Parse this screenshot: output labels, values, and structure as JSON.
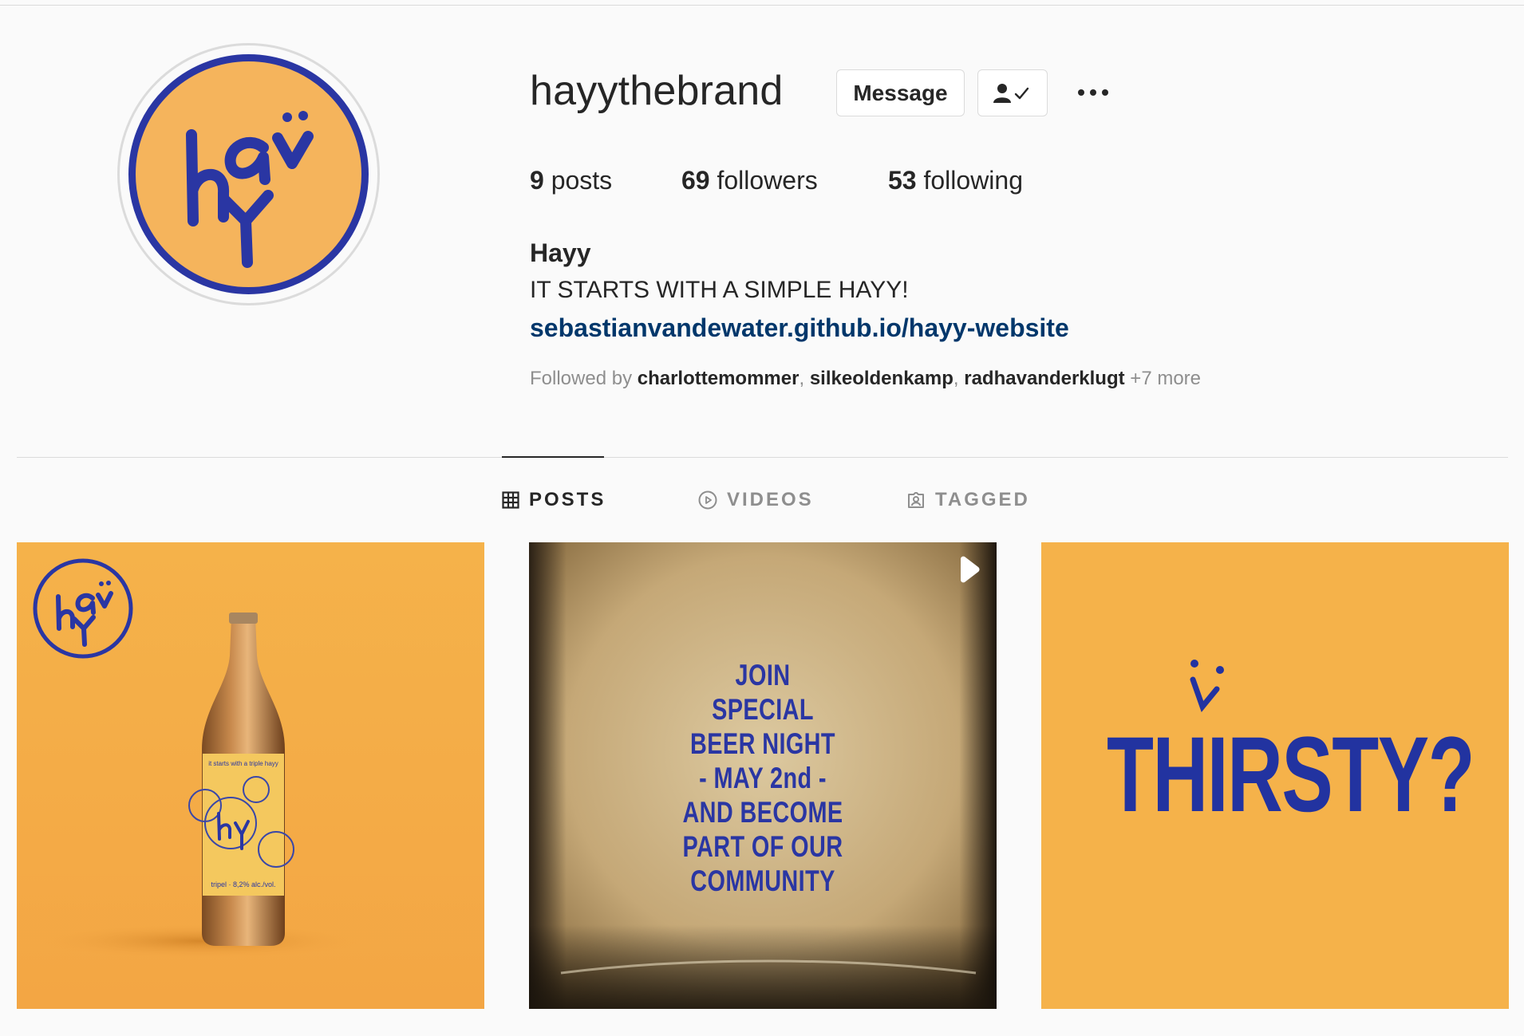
{
  "profile": {
    "username": "hayythebrand",
    "message_label": "Message",
    "stats": {
      "posts_count": "9",
      "posts_label": " posts",
      "followers_count": "69",
      "followers_label": " followers",
      "following_count": "53",
      "following_label": " following"
    },
    "full_name": "Hayy",
    "bio": "IT STARTS WITH A SIMPLE HAYY!",
    "link": "sebastianvandewater.github.io/hayy-website",
    "followed_by": {
      "prefix": "Followed by ",
      "users": [
        "charlottemommer",
        "silkeoldenkamp",
        "radhavanderklugt"
      ],
      "more": "+7 more"
    },
    "avatar_text": "hayy"
  },
  "tabs": [
    {
      "label": "POSTS",
      "icon": "grid-icon",
      "active": true
    },
    {
      "label": "VIDEOS",
      "icon": "play-circle-icon",
      "active": false
    },
    {
      "label": "TAGGED",
      "icon": "tag-user-icon",
      "active": false
    }
  ],
  "posts": [
    {
      "kind": "image",
      "logo_text": "hayy",
      "label_top": "it starts with a triple hayy",
      "label_bottom": "tripel · 8,2% alc./vol."
    },
    {
      "kind": "video",
      "caption_lines": [
        "JOIN",
        "SPECIAL",
        "BEER NIGHT",
        "- MAY 2nd -",
        "AND BECOME",
        "PART OF OUR",
        "COMMUNITY"
      ]
    },
    {
      "kind": "image",
      "headline": "THIRSTY?"
    }
  ],
  "colors": {
    "brand_orange": "#f5b45c",
    "brand_blue": "#2a36a3",
    "link": "#00376b",
    "muted": "#8e8e8e"
  }
}
